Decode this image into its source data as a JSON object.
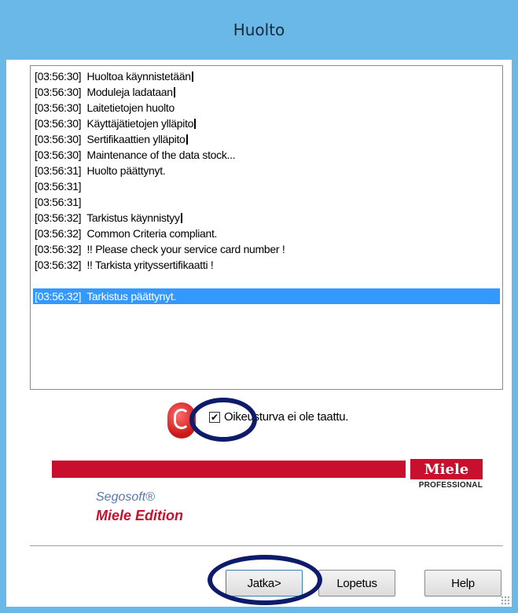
{
  "window": {
    "title": "Huolto"
  },
  "log": {
    "rows": [
      {
        "text": "[03:56:30]  Huoltoa käynnistetään",
        "cursor": true
      },
      {
        "text": "[03:56:30]  Moduleja ladataan",
        "cursor": true
      },
      {
        "text": "[03:56:30]  Laitetietojen huolto",
        "cursor": false
      },
      {
        "text": "[03:56:30]  Käyttäjätietojen ylläpito",
        "cursor": true
      },
      {
        "text": "[03:56:30]  Sertifikaattien ylläpito",
        "cursor": true
      },
      {
        "text": "[03:56:30]  Maintenance of the data stock...",
        "cursor": false
      },
      {
        "text": "[03:56:31]  Huolto päättynyt.",
        "cursor": false
      },
      {
        "text": "[03:56:31]",
        "cursor": false
      },
      {
        "text": "[03:56:31]",
        "cursor": false
      },
      {
        "text": "[03:56:32]  Tarkistus käynnistyy",
        "cursor": true
      },
      {
        "text": "[03:56:32]  Common Criteria compliant.",
        "cursor": false
      },
      {
        "text": "[03:56:32]  !! Please check your service card number !",
        "cursor": false
      },
      {
        "text": "[03:56:32]  !! Tarkista yrityssertifikaatti !",
        "cursor": false
      },
      {
        "text": "",
        "cursor": false
      },
      {
        "text": "[03:56:32]  Tarkistus päättynyt.",
        "cursor": false,
        "selected": true
      }
    ]
  },
  "warning": {
    "checkbox_checked": true,
    "label": "Oikeusturva ei ole taattu.",
    "icon": "warning-icon"
  },
  "branding": {
    "logo_text": "Miele",
    "logo_sub": "PROFESSIONAL",
    "product": "Segosoft®",
    "edition": "Miele Edition",
    "brand_color": "#c8102e"
  },
  "buttons": {
    "next": "Jatka>",
    "exit": "Lopetus",
    "help": "Help"
  }
}
